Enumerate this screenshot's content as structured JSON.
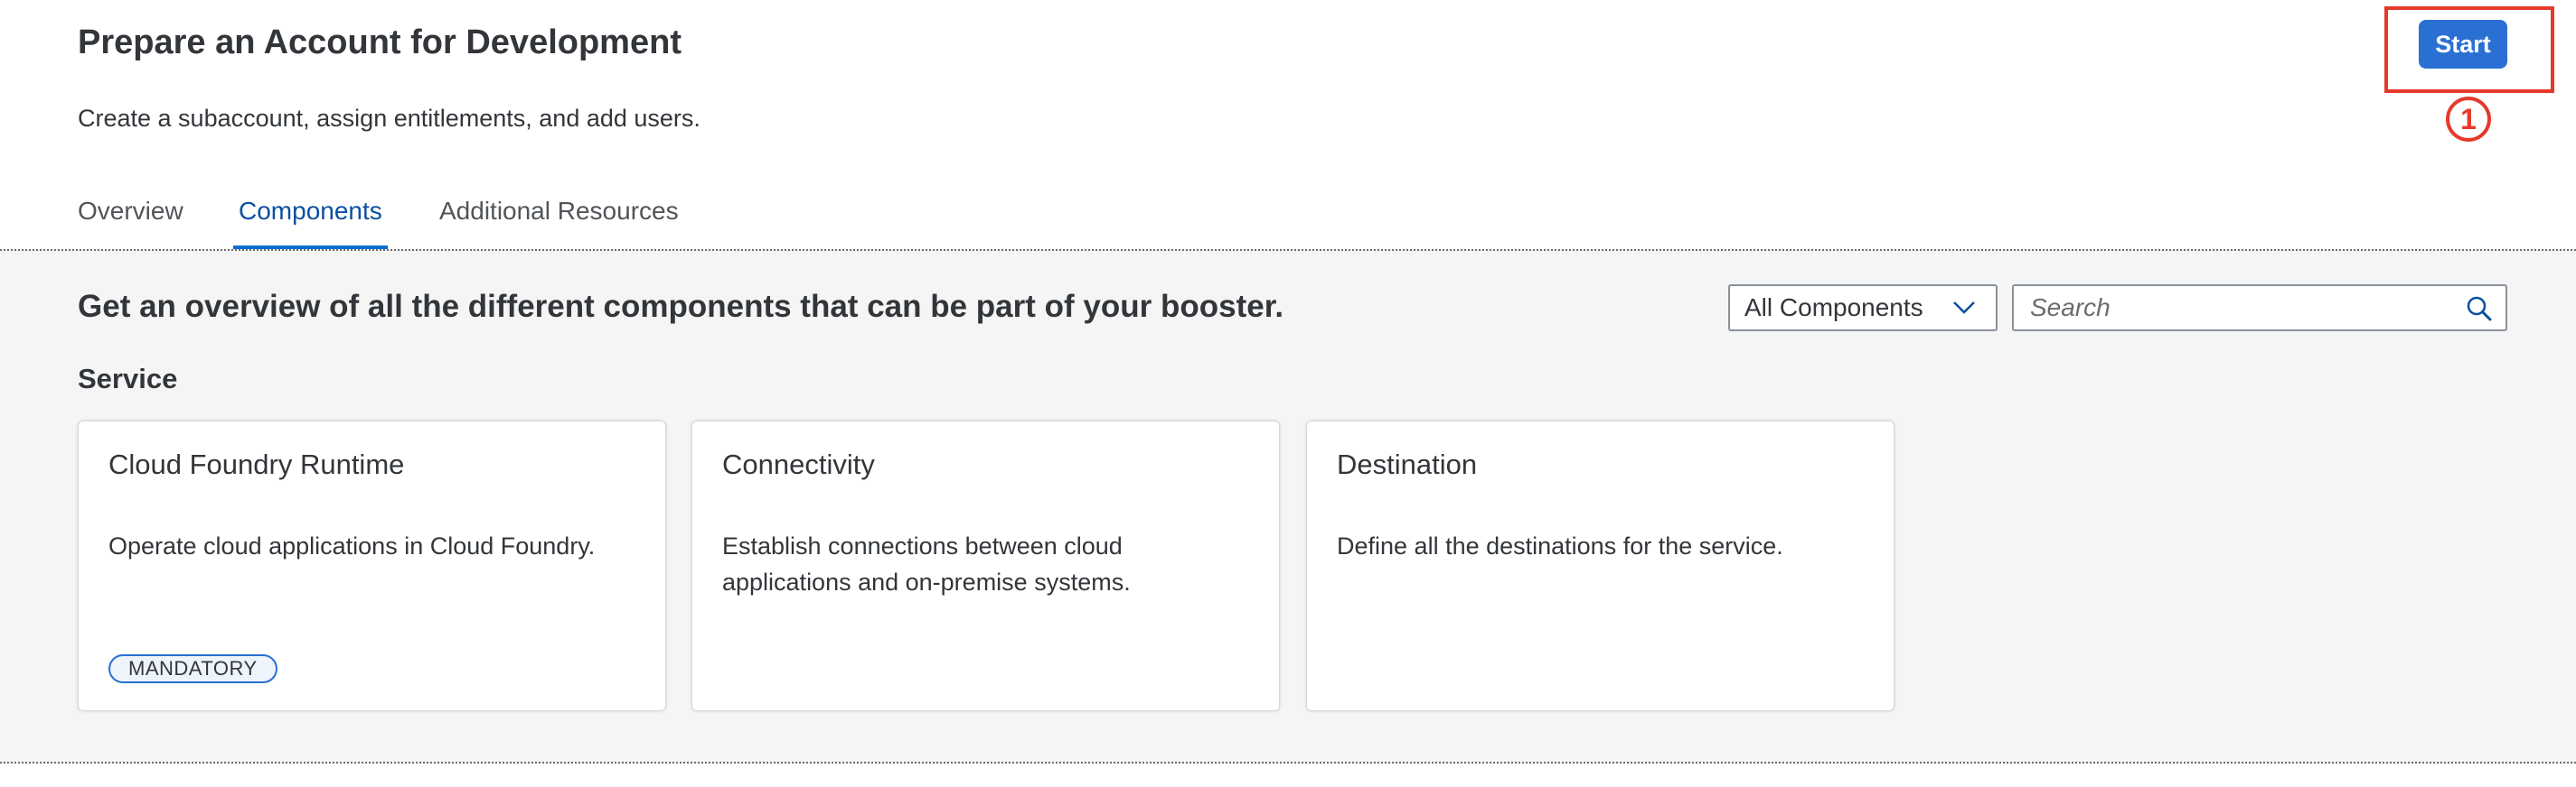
{
  "header": {
    "title": "Prepare an Account for Development",
    "subtitle": "Create a subaccount, assign entitlements, and add users.",
    "start_label": "Start",
    "step_marker": "1"
  },
  "tabs": [
    {
      "label": "Overview",
      "active": false
    },
    {
      "label": "Components",
      "active": true
    },
    {
      "label": "Additional Resources",
      "active": false
    }
  ],
  "content": {
    "heading": "Get an overview of all the different components that can be part of your booster.",
    "filter": {
      "selected": "All Components",
      "icon": "chevron-down-icon"
    },
    "search": {
      "placeholder": "Search",
      "value": "",
      "icon": "search-icon"
    },
    "section_title": "Service",
    "cards": [
      {
        "title": "Cloud Foundry Runtime",
        "description": "Operate cloud applications in Cloud Foundry.",
        "badge": "MANDATORY"
      },
      {
        "title": "Connectivity",
        "description": "Establish connections between cloud applications and on-premise systems.",
        "badge": ""
      },
      {
        "title": "Destination",
        "description": "Define all the destinations for the service.",
        "badge": ""
      }
    ]
  },
  "colors": {
    "accent": "#2a6fd2",
    "active_tab": "#0a4f9e",
    "highlight": "#e53a2b",
    "content_bg": "#f5f5f5"
  }
}
